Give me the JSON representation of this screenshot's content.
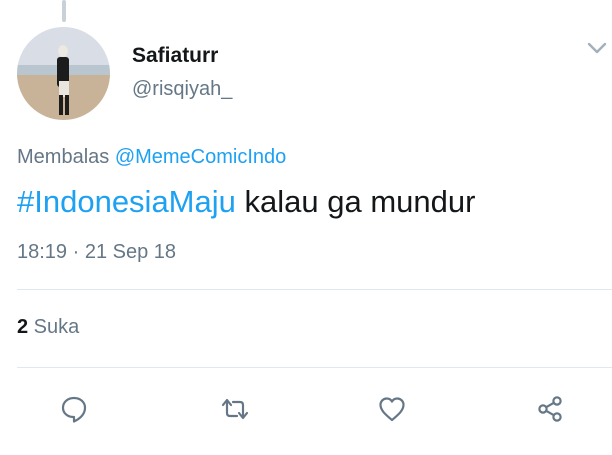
{
  "tweet": {
    "author_name": "Safiaturr",
    "author_handle": "@risqiyah_",
    "reply_prefix": "Membalas ",
    "reply_mention": "@MemeComicIndo",
    "hashtag": "#IndonesiaMaju",
    "text_rest": " kalau ga mundur",
    "timestamp": "18:19 · 21 Sep 18",
    "like_count": "2",
    "like_label": " Suka"
  },
  "colors": {
    "accent": "#1da1f2",
    "secondary_text": "#657786",
    "icon": "#657786",
    "divider": "#e1e8ed"
  },
  "icons": {
    "menu": "chevron-down-icon",
    "reply": "reply-icon",
    "retweet": "retweet-icon",
    "like": "heart-icon",
    "share": "share-icon"
  }
}
